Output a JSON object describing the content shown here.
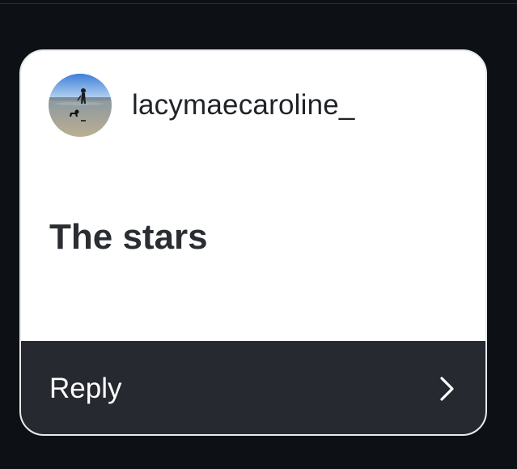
{
  "story_reply": {
    "username": "lacymaecaroline_",
    "message": "The stars",
    "reply_label": "Reply"
  },
  "icons": {
    "avatar": "profile-photo-beach-person-dog",
    "reply": "chevron-right-icon"
  },
  "colors": {
    "background": "#0d1015",
    "card": "#ffffff",
    "reply_bar": "#26292f",
    "text_dark": "#1f2328",
    "text_light": "#ffffff"
  }
}
